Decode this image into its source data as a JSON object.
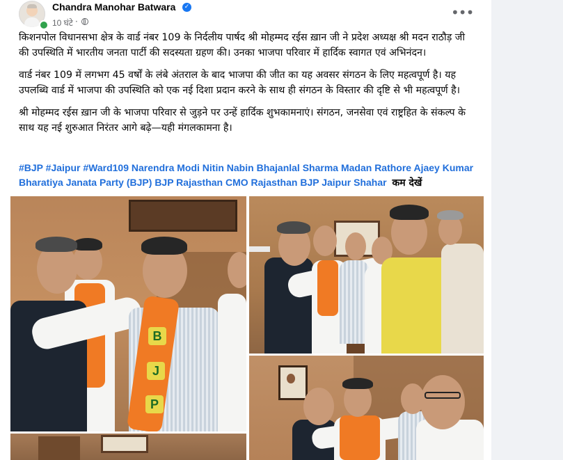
{
  "post": {
    "author_name": "Chandra Manohar Batwara",
    "timestamp": "10 घंटे",
    "separator": "·",
    "more_options_label": "•••",
    "verified_mark": "✓",
    "paragraphs": [
      "किशनपोल विधानसभा क्षेत्र के वार्ड नंबर 109 के निर्दलीय पार्षद श्री मोहम्मद रईस ख़ान जी ने प्रदेश अध्यक्ष श्री मदन राठौड़ जी की उपस्थिति में भारतीय जनता पार्टी की सदस्यता ग्रहण की। उनका भाजपा परिवार में हार्दिक स्वागत एवं अभिनंदन।",
      "वार्ड नंबर 109 में लगभग 45 वर्षों के लंबे अंतराल के बाद भाजपा की जीत का यह अवसर संगठन के लिए महत्वपूर्ण है। यह उपलब्धि वार्ड में भाजपा की उपस्थिति को एक नई दिशा प्रदान करने के साथ ही संगठन के विस्तार की दृष्टि से भी महत्वपूर्ण है।",
      "श्री मोहम्मद रईस ख़ान जी के भाजपा परिवार से जुड़ने पर उन्हें हार्दिक शुभकामनाएं। संगठन, जनसेवा एवं राष्ट्रहित के संकल्प के साथ यह नई शुरुआत निरंतर आगे बढ़े—यही मंगलकामना है।"
    ],
    "tags": [
      "#BJP",
      "#Jaipur",
      "#Ward109",
      "Narendra Modi",
      "Nitin Nabin",
      "Bhajanlal Sharma",
      "Madan Rathore",
      "Ajaey Kumar",
      "Bharatiya Janata Party (BJP)",
      "BJP Rajasthan",
      "CMO Rajasthan",
      "BJP Jaipur Shahar"
    ],
    "see_less_label": "कम देखें"
  },
  "photo_letters": [
    "B",
    "J",
    "P"
  ],
  "colors": {
    "link_blue": "#216fdb",
    "verified_blue": "#1877f2",
    "online_green": "#31a24c",
    "saffron": "#f07a24"
  },
  "icons": {
    "verified": "verified-badge-icon",
    "audience": "globe-icon",
    "more": "more-options-icon"
  }
}
